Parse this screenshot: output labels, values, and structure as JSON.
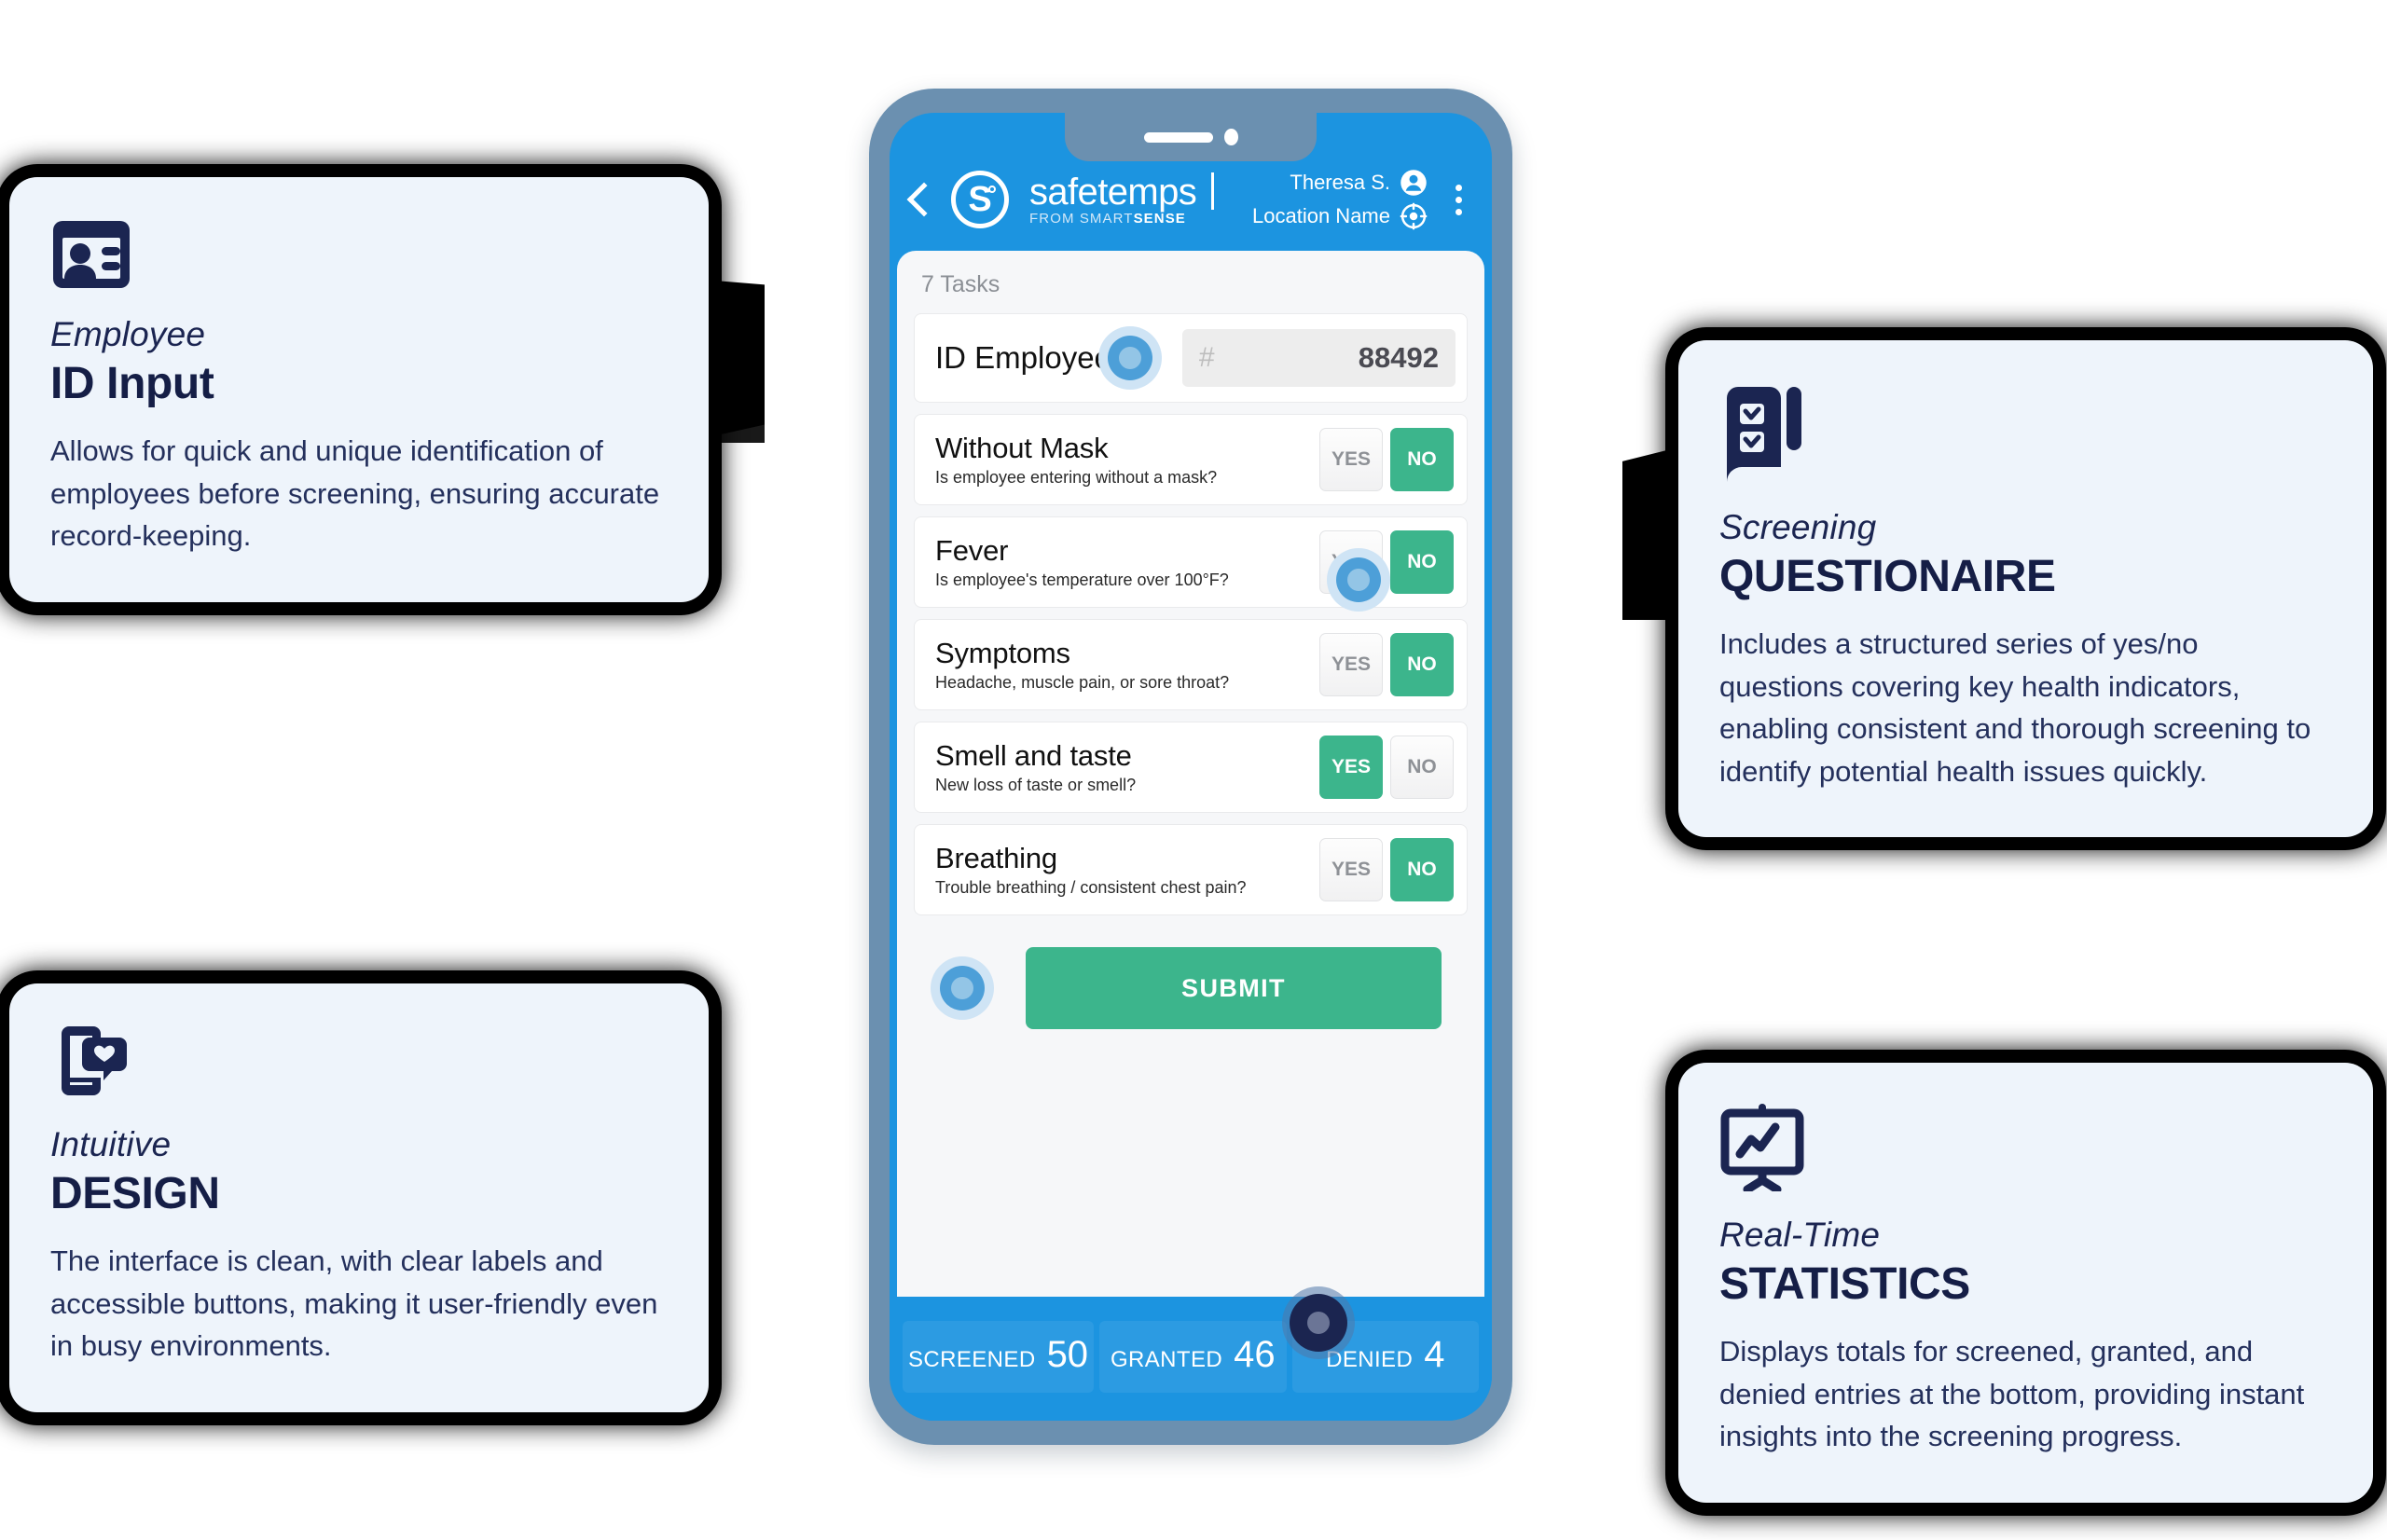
{
  "cards": [
    {
      "icon": "id-card-icon",
      "eyebrow": "Employee",
      "title": "ID Input",
      "body": "Allows for quick and unique identification of employees before screening, ensuring accurate record-keeping."
    },
    {
      "icon": "mobile-heart-icon",
      "eyebrow": "Intuitive",
      "title": "DESIGN",
      "body": "The interface is clean, with clear labels and accessible buttons, making it user-friendly even in busy environments."
    },
    {
      "icon": "checklist-icon",
      "eyebrow": "Screening",
      "title": "QUESTIONAIRE",
      "body": "Includes a structured series of yes/no questions covering key health indicators, enabling consistent and thorough screening to identify potential health issues quickly."
    },
    {
      "icon": "chart-board-icon",
      "eyebrow": "Real-Time",
      "title": "STATISTICS",
      "body": "Displays totals for screened, granted, and denied entries at the bottom, providing instant insights into the screening progress."
    }
  ],
  "phone": {
    "header": {
      "back_icon": "chevron-left-icon",
      "logo_letter": "S",
      "logo_degree": "°",
      "brand": "safetemps",
      "brand_sub_plain": "FROM SMART",
      "brand_sub_bold": "SENSE",
      "user_name": "Theresa S.",
      "user_icon": "user-avatar-icon",
      "location_name": "Location Name",
      "location_icon": "target-location-icon",
      "overflow_icon": "kebab-menu-icon"
    },
    "tasks_count": "7 Tasks",
    "id_row": {
      "label": "ID Employee",
      "ripple_icon": "tap-ripple-icon",
      "hash": "#",
      "value": "88492"
    },
    "questions": [
      {
        "title": "Without Mask",
        "subtitle": "Is employee entering without a mask?",
        "yes_label": "YES",
        "no_label": "NO",
        "selected": "NO"
      },
      {
        "title": "Fever",
        "subtitle": "Is employee's temperature over 100°F?",
        "yes_label": "YES",
        "no_label": "NO",
        "selected": "NO"
      },
      {
        "title": "Symptoms",
        "subtitle": "Headache, muscle pain, or sore throat?",
        "yes_label": "YES",
        "no_label": "NO",
        "selected": "NO"
      },
      {
        "title": "Smell and taste",
        "subtitle": "New loss of taste or smell?",
        "yes_label": "YES",
        "no_label": "NO",
        "selected": "YES"
      },
      {
        "title": "Breathing",
        "subtitle": "Trouble breathing / consistent chest pain?",
        "yes_label": "YES",
        "no_label": "NO",
        "selected": "NO"
      }
    ],
    "submit_label": "SUBMIT",
    "stats": [
      {
        "label": "SCREENED",
        "value": "50"
      },
      {
        "label": "GRANTED",
        "value": "46"
      },
      {
        "label": "DENIED",
        "value": "4"
      }
    ]
  },
  "colors": {
    "brand_blue": "#1c94e0",
    "accent_green": "#3cb58c",
    "card_bg": "#eef4fb",
    "navy": "#1b2551",
    "phone_frame": "#6b90b0"
  }
}
